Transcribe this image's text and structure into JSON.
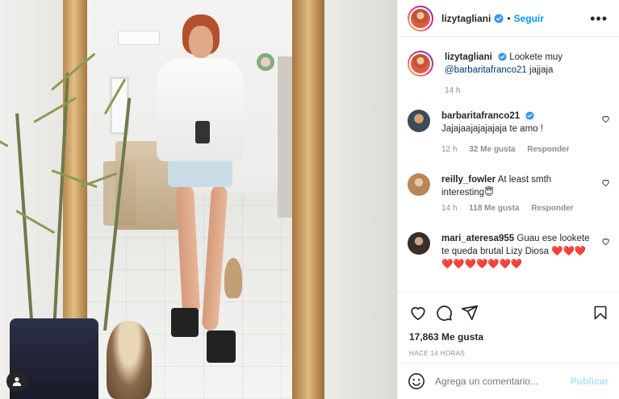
{
  "post": {
    "author": "lizytagliani",
    "follow_label": "Seguir",
    "dot": "•",
    "more": "•••"
  },
  "caption": {
    "username": "lizytagliani",
    "text": "Lookete muy",
    "mention": "@barbaritafranco21",
    "text_end": " jajjaja",
    "time": "14 h"
  },
  "comments": [
    {
      "username": "barbaritafranco21",
      "text": "Jajajaajajajajaja te amo !",
      "time": "12 h",
      "likes": "32 Me gusta",
      "reply": "Responder"
    },
    {
      "username": "reilly_fowler",
      "text": "At least smth interesting😇",
      "time": "14 h",
      "likes": "118 Me gusta",
      "reply": "Responder"
    },
    {
      "username": "mari_ateresa955",
      "text": "Guau ese lookete te queda brutal Lizy Diosa ❤️❤️❤️❤️❤️❤️❤️❤️❤️❤️",
      "time": "",
      "likes": "",
      "reply": ""
    }
  ],
  "stats": {
    "likes": "17,863 Me gusta",
    "ago": "HACE 14 HORAS"
  },
  "composer": {
    "placeholder": "Agrega un comentario...",
    "post_label": "Publicar"
  },
  "colors": {
    "accent": "#0095f6",
    "muted": "#8e8e8e",
    "publish_disabled": "#b2dffc",
    "heart_red": "#ed4956"
  },
  "icons": {
    "like": "heart-icon",
    "comment": "comment-icon",
    "share": "share-icon",
    "save": "bookmark-icon",
    "emoji": "emoji-icon",
    "verified": "verified-badge-icon",
    "more": "more-options-icon"
  }
}
